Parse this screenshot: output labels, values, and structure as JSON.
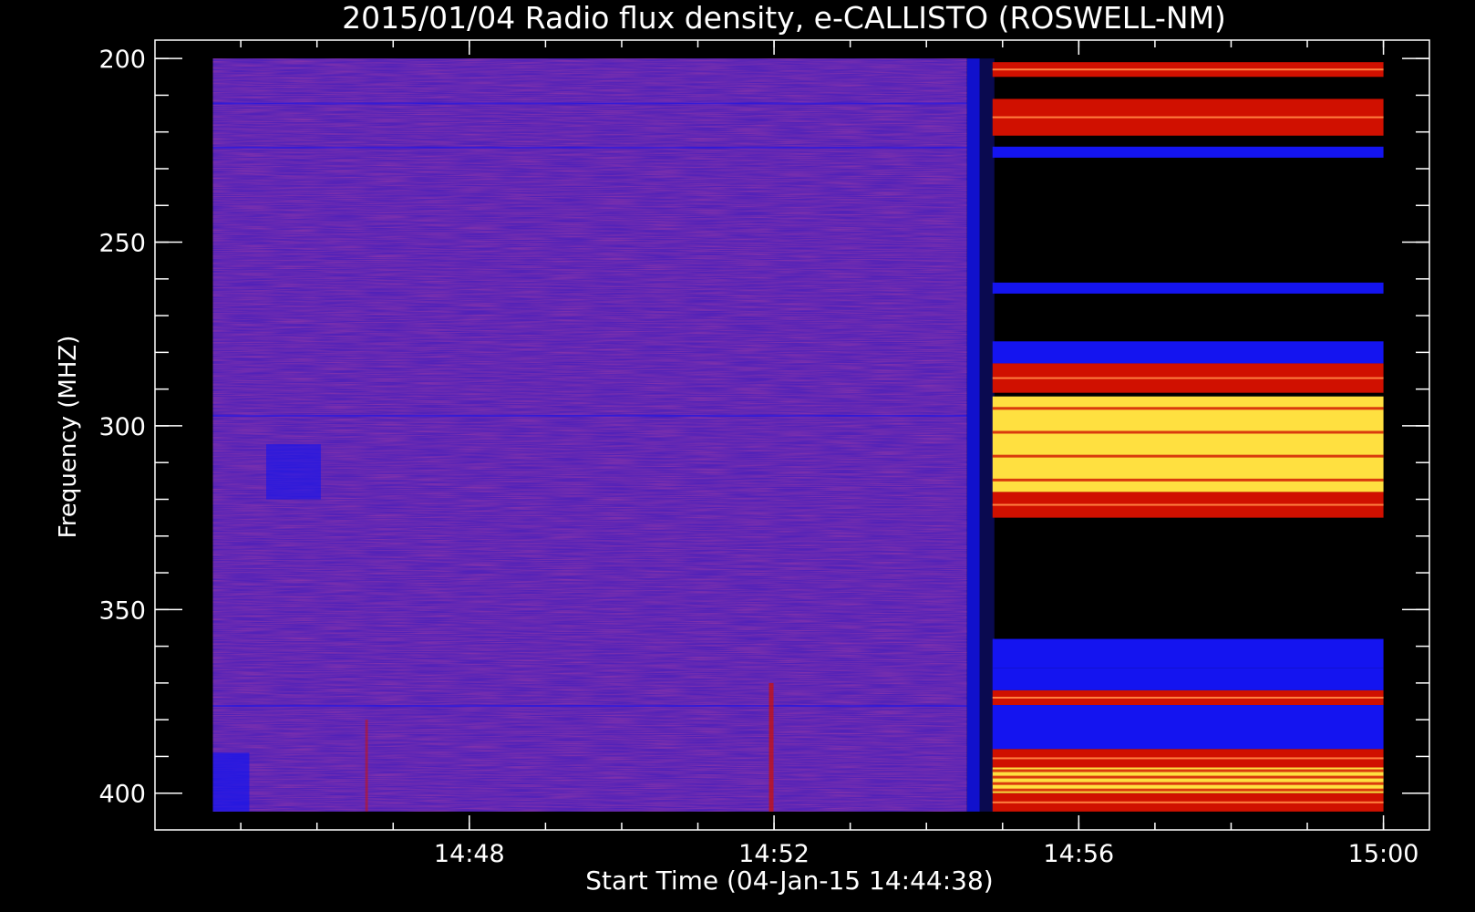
{
  "chart_data": {
    "type": "heatmap",
    "title": "2015/01/04  Radio flux density, e-CALLISTO (ROSWELL-NM)",
    "xlabel": "Start Time (04-Jan-15 14:44:38)",
    "ylabel": "Frequency (MHZ)",
    "x_tick_labels": [
      "14:48",
      "14:52",
      "14:56",
      "15:00"
    ],
    "x_tick_minutes": [
      3.3667,
      7.3667,
      11.3667,
      15.3667
    ],
    "x_minor_step_minutes": 1,
    "data_x_range_minutes": [
      0,
      15.3667
    ],
    "axis_x_range_minutes": [
      -0.76,
      15.97
    ],
    "y_ticks": [
      200,
      250,
      300,
      350,
      400
    ],
    "y_minor_step": 10,
    "ylim": [
      195,
      410
    ],
    "data_y_range": [
      200,
      405
    ],
    "y_inverted": true,
    "grid": false,
    "colormap": [
      "#000000",
      "#1010ff",
      "#c00000",
      "#ff3000",
      "#ffd000",
      "#ffff80"
    ],
    "background_level_color": "#5222b8",
    "event_onset_minutes": 9.9,
    "bright_bands": [
      {
        "f0": 201,
        "f1": 205,
        "level": "red"
      },
      {
        "f0": 211,
        "f1": 221,
        "level": "red"
      },
      {
        "f0": 224,
        "f1": 227,
        "level": "blue"
      },
      {
        "f0": 261,
        "f1": 264,
        "level": "blue"
      },
      {
        "f0": 277,
        "f1": 283,
        "level": "blue"
      },
      {
        "f0": 283,
        "f1": 291,
        "level": "red"
      },
      {
        "f0": 292,
        "f1": 318,
        "level": "yellow"
      },
      {
        "f0": 318,
        "f1": 325,
        "level": "red"
      },
      {
        "f0": 358,
        "f1": 366,
        "level": "blue"
      },
      {
        "f0": 366,
        "f1": 372,
        "level": "blue"
      },
      {
        "f0": 372,
        "f1": 376,
        "level": "red"
      },
      {
        "f0": 376,
        "f1": 388,
        "level": "blue"
      },
      {
        "f0": 388,
        "f1": 393,
        "level": "red"
      },
      {
        "f0": 393,
        "f1": 400,
        "level": "yellow"
      },
      {
        "f0": 400,
        "f1": 405,
        "level": "red"
      }
    ]
  },
  "colors": {
    "background": "#000000",
    "foreground": "#ffffff",
    "quiet_sun": "#5222b8",
    "blue": "#1414f0",
    "red": "#d01000",
    "yellow": "#ffe040"
  }
}
